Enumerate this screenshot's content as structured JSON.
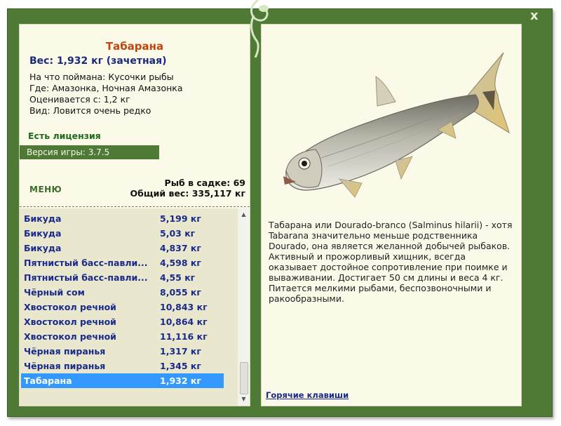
{
  "window": {
    "close_label": "x"
  },
  "fish": {
    "name": "Табарана",
    "weight": "Вес: 1,932 кг (зачетная)",
    "caught_on": "На что поймана: Кусочки рыбы",
    "where": "Где: Амазонка, Ночная Амазонка",
    "valued_from": "Оценивается с: 1,2 кг",
    "species": "Вид: Ловится очень редко"
  },
  "license": "Есть лицензия",
  "version": "Версия игры: 3.7.5",
  "menu_label": "МЕНЮ",
  "sadok": {
    "count": "Рыб в садке: 69",
    "total": "Общий вес: 335,117 кг"
  },
  "catch_list": [
    {
      "name": "Бикуда",
      "weight": "5,199 кг"
    },
    {
      "name": "Бикуда",
      "weight": "5,03 кг"
    },
    {
      "name": "Бикуда",
      "weight": "4,837 кг"
    },
    {
      "name": "Пятнистый басс-павли...",
      "weight": "4,598 кг"
    },
    {
      "name": "Пятнистый басс-павли...",
      "weight": "4,55 кг"
    },
    {
      "name": "Чёрный сом",
      "weight": "8,055 кг"
    },
    {
      "name": "Хвостокол речной",
      "weight": "10,843 кг"
    },
    {
      "name": "Хвостокол речной",
      "weight": "10,864 кг"
    },
    {
      "name": "Хвостокол речной",
      "weight": "11,116 кг"
    },
    {
      "name": "Чёрная пиранья",
      "weight": "1,317 кг"
    },
    {
      "name": "Чёрная пиранья",
      "weight": "1,345 кг"
    },
    {
      "name": "Табарана",
      "weight": "1,932 кг"
    }
  ],
  "selected_index": 11,
  "description": "Табарана или Dourado-branco (Salminus hilarii) - хотя Tabarana значительно меньше родственника Dourado, она является желанной добычей рыбаков. Активный и прожорливый хищник, всегда оказывает достойное сопротивление при поимке и вываживании. Достигает 50 см длины и веса 4 кг. Питается мелкими рыбами, беспозвоночными и ракообразными.",
  "hotkeys_label": "Горячие клавиши",
  "colors": {
    "frame": "#4f7a35",
    "panel": "#fbf9e8",
    "title": "#c0450f",
    "weight": "#1a2a7e",
    "license": "#1f6a1c",
    "list_text": "#1a2a8a",
    "selected": "#3399ff"
  }
}
